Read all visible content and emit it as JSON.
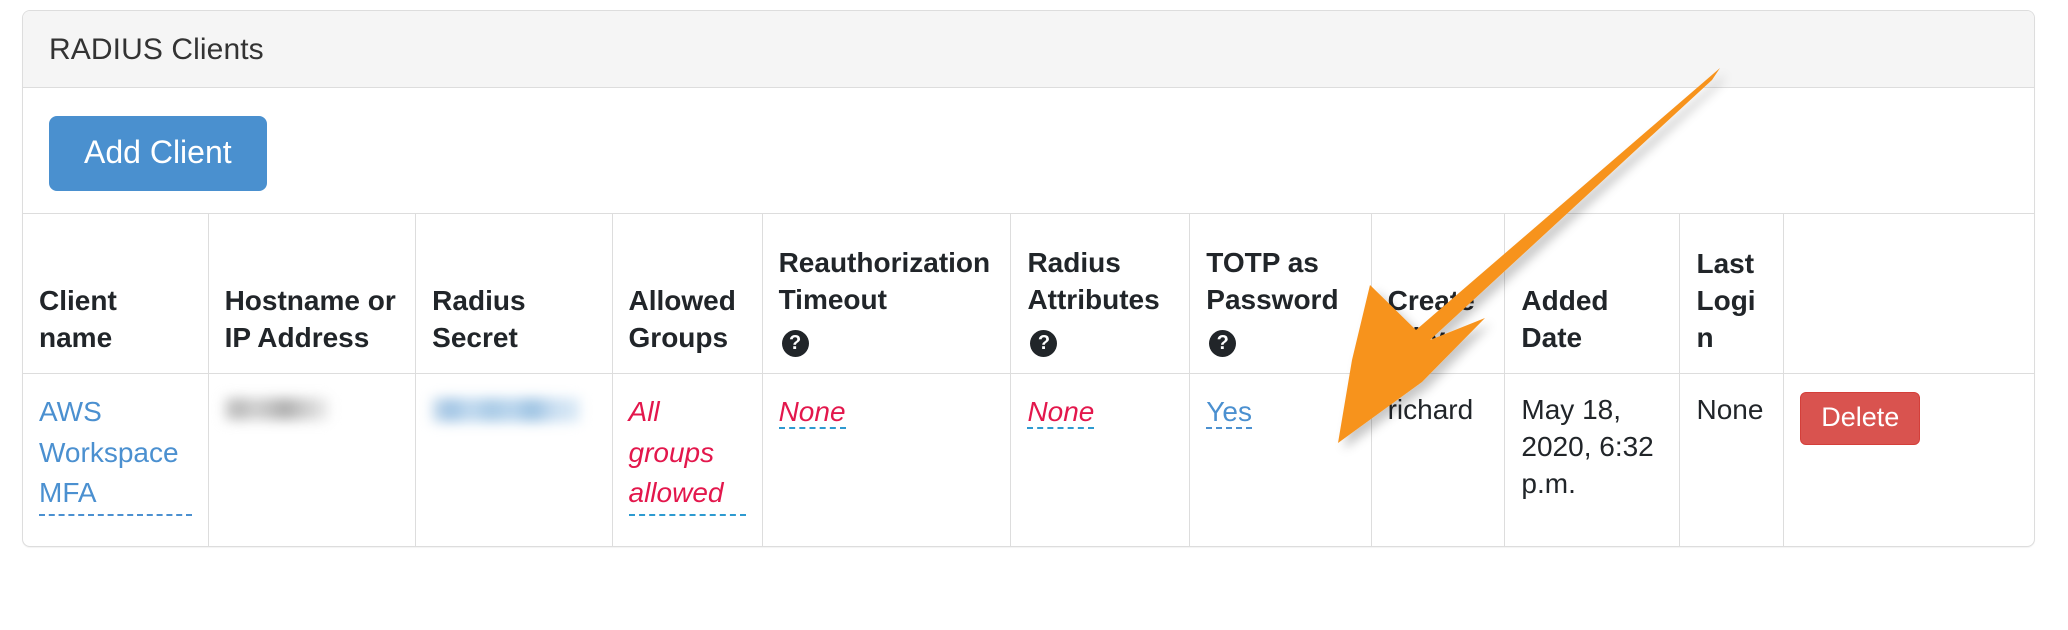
{
  "card": {
    "title": "RADIUS Clients",
    "add_client_label": "Add Client"
  },
  "table": {
    "columns": [
      {
        "label": "Client name",
        "help": false
      },
      {
        "label": "Hostname or IP Address",
        "help": false
      },
      {
        "label": "Radius Secret",
        "help": false
      },
      {
        "label": "Allowed Groups",
        "help": false
      },
      {
        "label": "Reauthorization Timeout",
        "help": true
      },
      {
        "label": "Radius Attributes",
        "help": true
      },
      {
        "label": "TOTP as Password",
        "help": true
      },
      {
        "label": "Created by",
        "help": false
      },
      {
        "label": "Added Date",
        "help": false
      },
      {
        "label": "Last Login",
        "help": false
      },
      {
        "label": "",
        "help": false
      }
    ],
    "help_glyph": "?",
    "rows": [
      {
        "client_name": "AWS Workspace MFA",
        "hostname": "",
        "radius_secret": "",
        "allowed_groups": "All groups allowed",
        "reauthorization_timeout": "None",
        "radius_attributes": "None",
        "totp_as_password": "Yes",
        "created_by": "richard",
        "added_date": "May 18, 2020, 6:32 p.m.",
        "last_login": "None",
        "delete_label": "Delete"
      }
    ]
  },
  "annotation": {
    "arrow_color": "#f7931e",
    "points_to": "totp-as-password-value"
  },
  "colors": {
    "primary_button": "#4a90cf",
    "danger_button": "#d9534f",
    "link": "#4b90d0",
    "editable_red": "#e3174c",
    "header_background": "#f5f5f5",
    "border": "#dddddd"
  }
}
